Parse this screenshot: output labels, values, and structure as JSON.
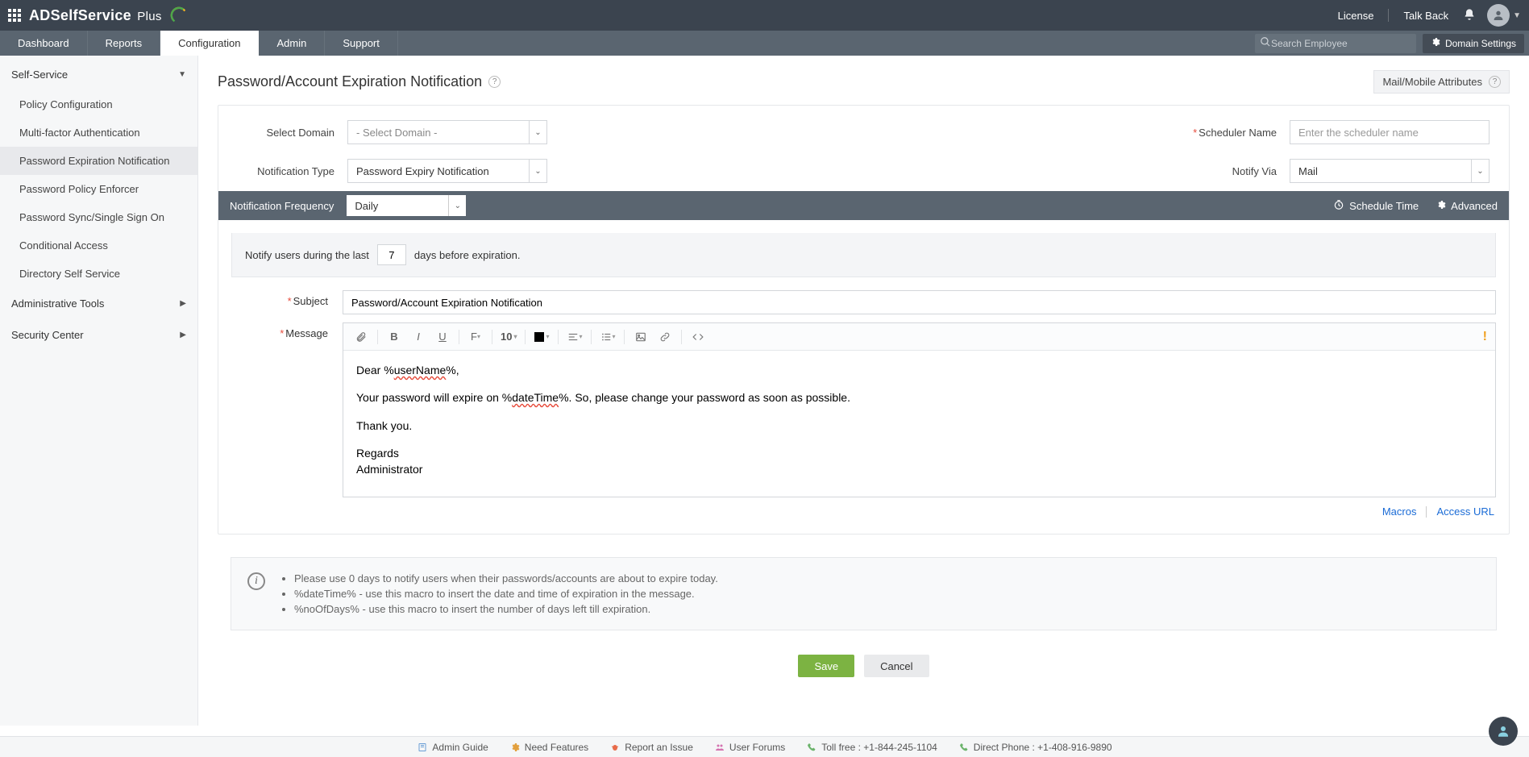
{
  "topbar": {
    "brand_main": "ADSelfService",
    "brand_plus": "Plus",
    "license": "License",
    "talkback": "Talk Back",
    "search_placeholder": "Search Employee",
    "domain_settings": "Domain Settings"
  },
  "navtabs": [
    "Dashboard",
    "Reports",
    "Configuration",
    "Admin",
    "Support"
  ],
  "navtab_active": "Configuration",
  "sidebar": {
    "groups": [
      {
        "label": "Self-Service",
        "open": true,
        "items": [
          "Policy Configuration",
          "Multi-factor Authentication",
          "Password Expiration Notification",
          "Password Policy Enforcer",
          "Password Sync/Single Sign On",
          "Conditional Access",
          "Directory Self Service"
        ],
        "active": "Password Expiration Notification"
      },
      {
        "label": "Administrative Tools",
        "open": false
      },
      {
        "label": "Security Center",
        "open": false
      }
    ]
  },
  "page": {
    "title": "Password/Account Expiration Notification",
    "mma": "Mail/Mobile Attributes"
  },
  "config": {
    "select_domain_label": "Select Domain",
    "select_domain_placeholder": "- Select Domain -",
    "notif_type_label": "Notification Type",
    "notif_type_value": "Password Expiry Notification",
    "scheduler_label": "Scheduler Name",
    "scheduler_placeholder": "Enter the scheduler name",
    "notify_via_label": "Notify Via",
    "notify_via_value": "Mail"
  },
  "freqbar": {
    "label": "Notification Frequency",
    "value": "Daily",
    "schedule": "Schedule Time",
    "advanced": "Advanced"
  },
  "notify_row": {
    "pre": "Notify users during the last",
    "days": "7",
    "post": "days before expiration."
  },
  "editor": {
    "subject_label": "Subject",
    "subject_value": "Password/Account Expiration Notification",
    "message_label": "Message",
    "font_size": "10",
    "body_greeting_pre": "Dear %",
    "body_greeting_macro": "userName",
    "body_greeting_post": "%,",
    "body_line2_pre": "Your password will expire on %",
    "body_line2_macro": "dateTime",
    "body_line2_post": "%. So, please change your password as soon as possible.",
    "body_line3": "Thank you.",
    "body_sig1": "Regards",
    "body_sig2": "Administrator",
    "macros_link": "Macros",
    "access_url_link": "Access URL"
  },
  "notes": [
    "Please use 0 days to notify users when their passwords/accounts are about to expire today.",
    "%dateTime% - use this macro to insert the date and time of expiration in the message.",
    "%noOfDays% - use this macro to insert the number of days left till expiration."
  ],
  "buttons": {
    "save": "Save",
    "cancel": "Cancel"
  },
  "footer": {
    "admin_guide": "Admin Guide",
    "need_features": "Need Features",
    "report_issue": "Report an Issue",
    "user_forums": "User Forums",
    "toll_free": "Toll free : +1-844-245-1104",
    "direct": "Direct Phone : +1-408-916-9890"
  }
}
